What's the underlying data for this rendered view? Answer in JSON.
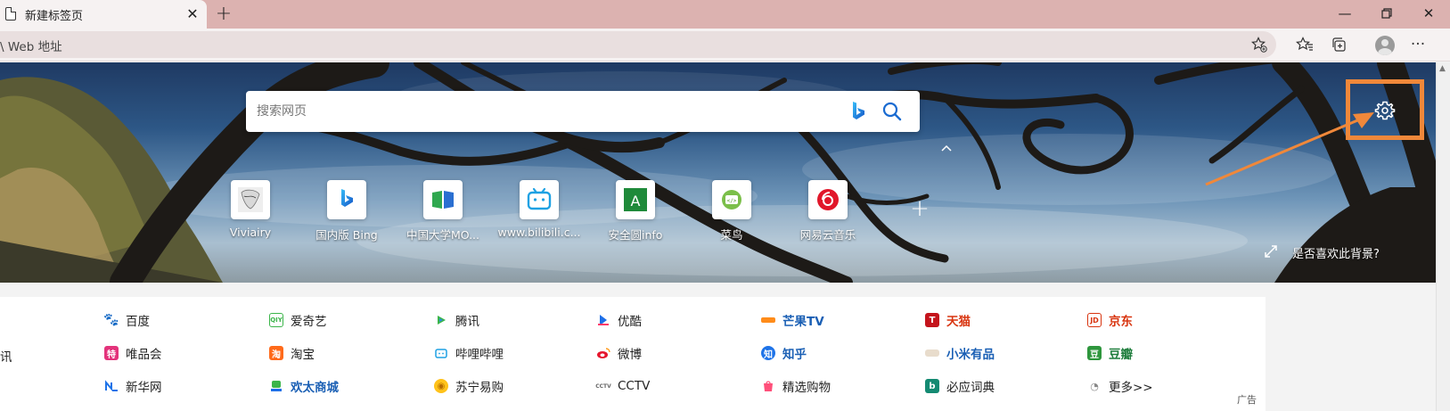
{
  "browser": {
    "tab_title": "新建标签页",
    "address_placeholder": "\\ Web 地址"
  },
  "search": {
    "placeholder": "搜索网页"
  },
  "quick_links": [
    {
      "label": "Viviairy",
      "icon": "manga-avatar-icon"
    },
    {
      "label": "国内版 Bing",
      "icon": "bing-icon"
    },
    {
      "label": "中国大学MO...",
      "icon": "mooc-book-icon"
    },
    {
      "label": "www.bilibili.c...",
      "icon": "bilibili-tv-icon"
    },
    {
      "label": "安全圆info",
      "icon": "letter-a-icon"
    },
    {
      "label": "菜鸟",
      "icon": "runoob-icon"
    },
    {
      "label": "网易云音乐",
      "icon": "netease-music-icon"
    }
  ],
  "background": {
    "like_question": "是否喜欢此背景?"
  },
  "link_grid": {
    "partial_left": "讯",
    "rows": [
      [
        "百度",
        "爱奇艺",
        "腾讯",
        "优酷",
        "芒果TV",
        "天猫",
        "京东"
      ],
      [
        "唯品会",
        "淘宝",
        "哔哩哔哩",
        "微博",
        "知乎",
        "小米有品",
        "豆瓣"
      ],
      [
        "新华网",
        "欢太商城",
        "苏宁易购",
        "CCTV",
        "精选购物",
        "必应词典",
        "更多>>"
      ]
    ],
    "ad_label": "广告"
  },
  "colors": {
    "highlight": "#f0883a",
    "tabstrip": "#dcb2b0",
    "link_blue": "#1a5fb4",
    "link_red": "#d8340f"
  }
}
